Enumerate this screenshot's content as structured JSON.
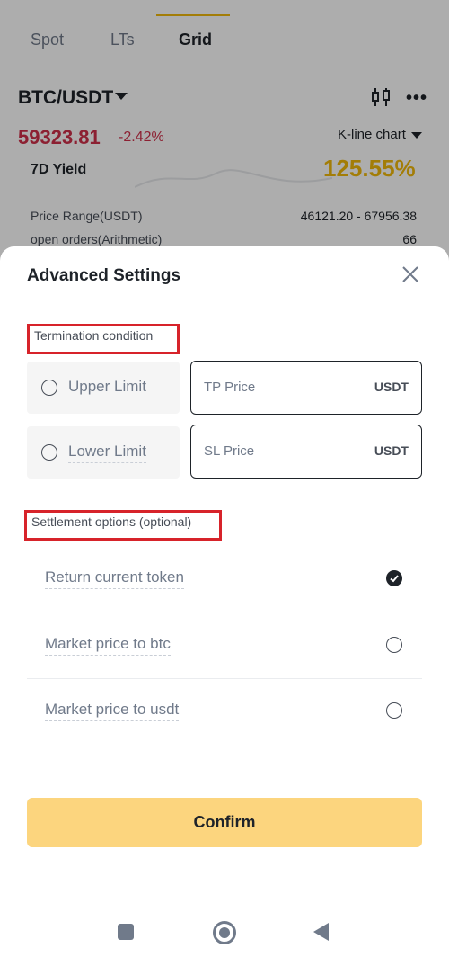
{
  "tabs": [
    {
      "label": "Spot"
    },
    {
      "label": "LTs"
    },
    {
      "label": "Grid"
    }
  ],
  "ticker": {
    "pair": "BTC/USDT",
    "price": "59323.81",
    "change": "-2.42%",
    "kline_label": "K-line chart"
  },
  "strategy": {
    "yield_label": "7D Yield",
    "yield_value": "125.55%",
    "range_label": "Price Range(USDT)",
    "range_value": "46121.20 - 67956.38",
    "orders_label": "open orders(Arithmetic)",
    "orders_value": "66"
  },
  "sheet": {
    "title": "Advanced Settings",
    "termination_label": "Termination condition",
    "upper_limit": "Upper Limit",
    "lower_limit": "Lower Limit",
    "tp_placeholder": "TP Price",
    "sl_placeholder": "SL Price",
    "unit": "USDT",
    "settlement_label": "Settlement options (optional)",
    "options": [
      {
        "label": "Return current token",
        "selected": true
      },
      {
        "label": "Market price to btc",
        "selected": false
      },
      {
        "label": "Market price to usdt",
        "selected": false
      }
    ],
    "confirm": "Confirm"
  },
  "colors": {
    "accent": "#f0b90b",
    "confirm_bg": "#fcd57e",
    "negative": "#cf304a",
    "highlight_box": "#d7232a"
  }
}
